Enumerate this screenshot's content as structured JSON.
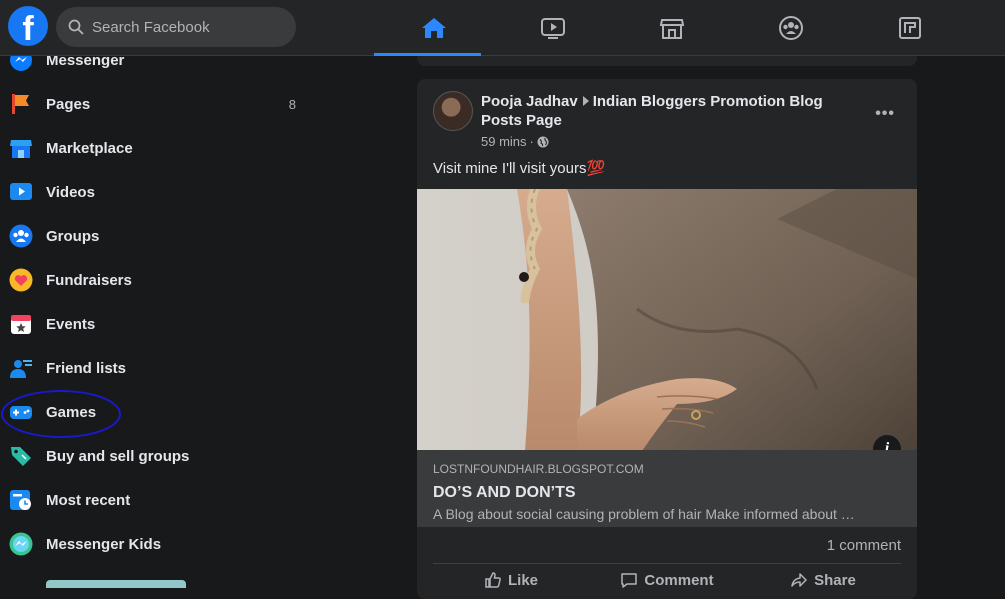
{
  "topbar": {
    "logo_letter": "f",
    "search_placeholder": "Search Facebook",
    "nav_tabs": [
      {
        "icon": "home-icon",
        "active": true
      },
      {
        "icon": "watch-icon",
        "active": false
      },
      {
        "icon": "marketplace-icon",
        "active": false
      },
      {
        "icon": "groups-icon",
        "active": false
      },
      {
        "icon": "gaming-icon",
        "active": false
      }
    ]
  },
  "sidebar": {
    "items": [
      {
        "label": "Messenger",
        "icon": "messenger-icon",
        "count": ""
      },
      {
        "label": "Pages",
        "icon": "flag-icon",
        "count": "8"
      },
      {
        "label": "Marketplace",
        "icon": "store-icon",
        "count": ""
      },
      {
        "label": "Videos",
        "icon": "video-icon",
        "count": ""
      },
      {
        "label": "Groups",
        "icon": "groups-icon",
        "count": ""
      },
      {
        "label": "Fundraisers",
        "icon": "heart-icon",
        "count": ""
      },
      {
        "label": "Events",
        "icon": "calendar-icon",
        "count": ""
      },
      {
        "label": "Friend lists",
        "icon": "friends-icon",
        "count": ""
      },
      {
        "label": "Games",
        "icon": "gamepad-icon",
        "count": ""
      },
      {
        "label": "Buy and sell groups",
        "icon": "tag-icon",
        "count": ""
      },
      {
        "label": "Most recent",
        "icon": "clock-feed-icon",
        "count": ""
      },
      {
        "label": "Messenger Kids",
        "icon": "messenger-kids-icon",
        "count": ""
      }
    ]
  },
  "post": {
    "author": "Pooja Jadhav",
    "group": "Indian Bloggers Promotion Blog Posts Page",
    "time": "59 mins",
    "text": "Visit mine I'll visit yours💯",
    "link": {
      "domain": "LOSTNFOUNDHAIR.BLOGSPOT.COM",
      "title": "DO’S AND DON’TS",
      "description": "A Blog about social causing problem of hair Make informed about …"
    },
    "comments": "1 comment",
    "actions": {
      "like": "Like",
      "comment": "Comment",
      "share": "Share"
    }
  },
  "colors": {
    "accent": "#2d88ff",
    "background": "#18191a",
    "surface": "#242526",
    "annotation": "#1a1acc"
  }
}
